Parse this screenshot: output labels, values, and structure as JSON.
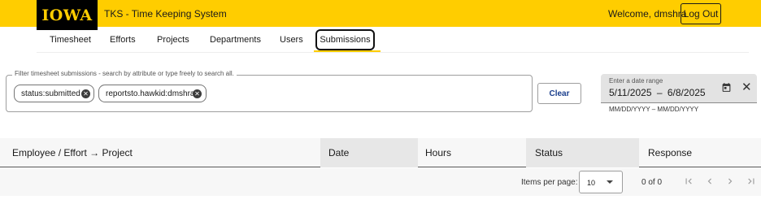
{
  "header": {
    "logo": "IOWA",
    "app_title": "TKS - Time Keeping System",
    "welcome": "Welcome, dmshra",
    "logout_label": "Log Out"
  },
  "nav": {
    "tabs": [
      {
        "label": "Timesheet"
      },
      {
        "label": "Efforts"
      },
      {
        "label": "Projects"
      },
      {
        "label": "Departments"
      },
      {
        "label": "Users"
      },
      {
        "label": "Submissions",
        "active": true
      }
    ]
  },
  "filter": {
    "legend": "Filter timesheet submissions - search by attribute or type freely to search all.",
    "chips": [
      {
        "label": "status:submitted"
      },
      {
        "label": "reportsto.hawkid:dmshra"
      }
    ],
    "clear_label": "Clear"
  },
  "date_range": {
    "label": "Enter a date range",
    "start": "5/11/2025",
    "separator": "–",
    "end": "6/8/2025",
    "hint": "MM/DD/YYYY – MM/DD/YYYY"
  },
  "table": {
    "columns": [
      {
        "label": "Employee / Effort → Project"
      },
      {
        "label": "Date"
      },
      {
        "label": "Hours"
      },
      {
        "label": "Status"
      },
      {
        "label": "Response"
      }
    ],
    "rows": []
  },
  "paginator": {
    "items_per_page_label": "Items per page:",
    "items_per_page": "10",
    "range_label": "0 of 0"
  },
  "colors": {
    "brand_gold": "#ffcd00",
    "brand_black": "#000000",
    "link_blue": "#1a3e8c"
  }
}
